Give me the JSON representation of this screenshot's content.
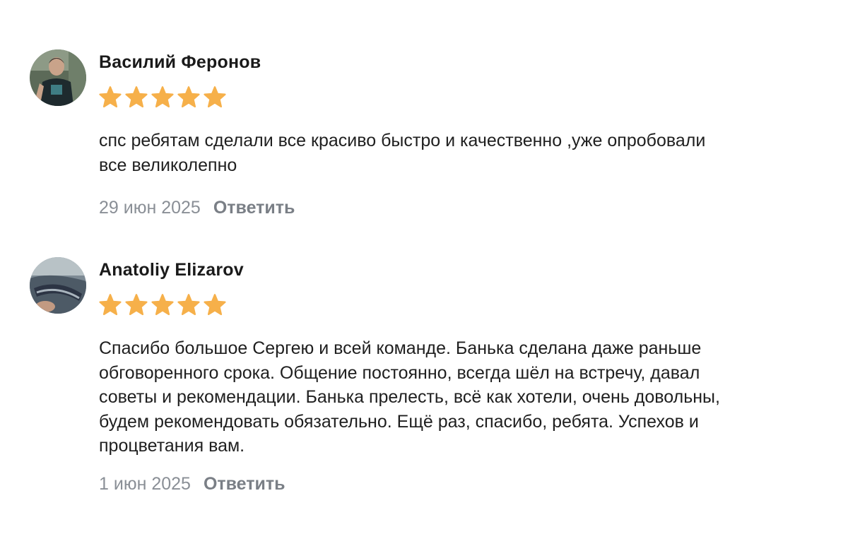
{
  "colors": {
    "star": "#f6b04a",
    "date": "#8a8f96",
    "reply": "#7a7f86",
    "author": "#1a1a1a",
    "text": "#1f1f1f"
  },
  "reviews": [
    {
      "author": "Василий Феронов",
      "rating": 5,
      "text": "спс ребятам сделали все красиво быстро и качественно ,уже опробовали\nвсе великолепно",
      "date": "29 июн 2025",
      "reply_label": "Ответить"
    },
    {
      "author": "Anatoliy Elizarov",
      "rating": 5,
      "text": "Спасибо большое Сергею и всей команде. Банька сделана даже раньше\nобговоренного срока. Общение постоянно, всегда шёл на встречу, давал\nсоветы и рекомендации. Банька прелесть, всё как хотели, очень довольны,\nбудем рекомендовать обязательно. Ещё раз, спасибо, ребята. Успехов и\nпроцветания вам.",
      "date": "1 июн 2025",
      "reply_label": "Ответить"
    }
  ]
}
